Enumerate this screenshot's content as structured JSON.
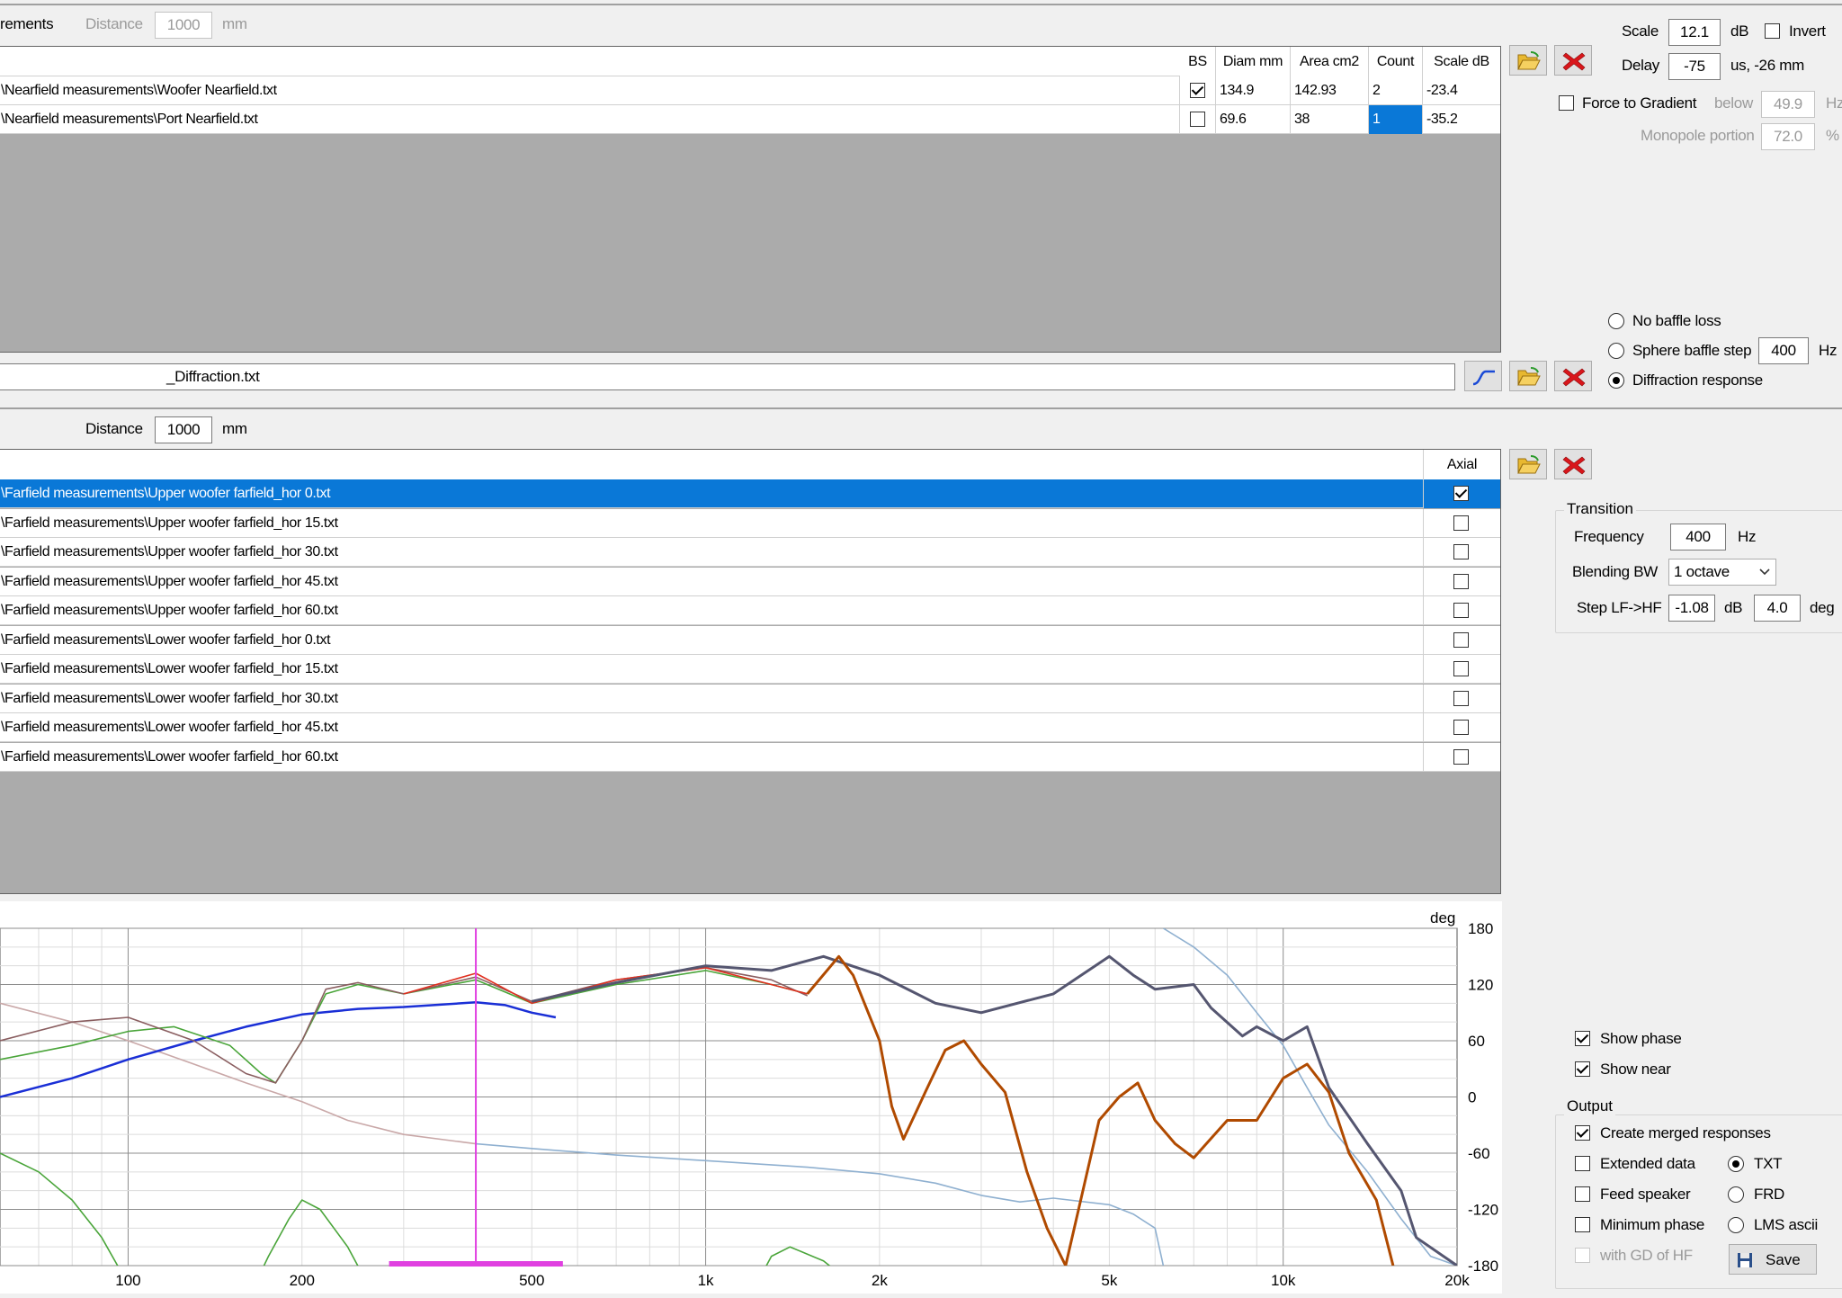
{
  "near_section": {
    "title_fragment": "rements",
    "distance_label": "Distance",
    "distance_value": "1000",
    "distance_unit": "mm",
    "columns": [
      "BS",
      "Diam mm",
      "Area cm2",
      "Count",
      "Scale dB"
    ],
    "rows": [
      {
        "file": "\\Nearfield measurements\\Woofer Nearfield.txt",
        "bs": true,
        "diam": "134.9",
        "area": "142.93",
        "count": "2",
        "scale": "-23.4"
      },
      {
        "file": "\\Nearfield measurements\\Port Nearfield.txt",
        "bs": false,
        "diam": "69.6",
        "area": "38",
        "count": "1",
        "scale": "-35.2"
      }
    ],
    "scale_label": "Scale",
    "scale_value": "12.1",
    "scale_unit": "dB",
    "invert_label": "Invert",
    "delay_label": "Delay",
    "delay_value": "-75",
    "delay_unit": "us, -26 mm",
    "force_gradient_label": "Force to Gradient",
    "below_label": "below",
    "below_value": "49.9",
    "below_unit": "Hz",
    "monopole_label": "Monopole portion",
    "monopole_value": "72.0",
    "monopole_unit": "%",
    "baffle_options": {
      "no_loss": "No baffle loss",
      "sphere": "Sphere baffle step",
      "diffraction": "Diffraction response"
    },
    "selected_baffle": "diffraction",
    "sphere_value": "400",
    "sphere_unit": "Hz",
    "diffraction_file": "_Diffraction.txt"
  },
  "far_section": {
    "distance_label": "Distance",
    "distance_value": "1000",
    "distance_unit": "mm",
    "axial_header": "Axial",
    "rows": [
      {
        "file": "\\Farfield measurements\\Upper woofer farfield_hor 0.txt",
        "axial": true
      },
      {
        "file": "\\Farfield measurements\\Upper woofer farfield_hor 15.txt",
        "axial": false
      },
      {
        "file": "\\Farfield measurements\\Upper woofer farfield_hor 30.txt",
        "axial": false
      },
      {
        "file": "\\Farfield measurements\\Upper woofer farfield_hor 45.txt",
        "axial": false
      },
      {
        "file": "\\Farfield measurements\\Upper woofer farfield_hor 60.txt",
        "axial": false
      },
      {
        "file": "\\Farfield measurements\\Lower woofer farfield_hor 0.txt",
        "axial": false
      },
      {
        "file": "\\Farfield measurements\\Lower woofer farfield_hor 15.txt",
        "axial": false
      },
      {
        "file": "\\Farfield measurements\\Lower woofer farfield_hor 30.txt",
        "axial": false
      },
      {
        "file": "\\Farfield measurements\\Lower woofer farfield_hor 45.txt",
        "axial": false
      },
      {
        "file": "\\Farfield measurements\\Lower woofer farfield_hor 60.txt",
        "axial": false
      }
    ]
  },
  "transition": {
    "title": "Transition",
    "frequency_label": "Frequency",
    "frequency_value": "400",
    "frequency_unit": "Hz",
    "blending_label": "Blending BW",
    "blending_value": "1 octave",
    "step_label": "Step LF->HF",
    "step_db_value": "-1.08",
    "step_db_unit": "dB",
    "step_deg_value": "4.0",
    "step_deg_unit": "deg"
  },
  "display": {
    "show_phase_label": "Show phase",
    "show_phase": true,
    "show_near_label": "Show near",
    "show_near": true
  },
  "output": {
    "title": "Output",
    "create_merged_label": "Create merged responses",
    "create_merged": true,
    "extended_label": "Extended data",
    "feed_label": "Feed speaker",
    "minphase_label": "Minimum phase",
    "gd_label": "with GD of HF",
    "formats": [
      "TXT",
      "FRD",
      "LMS ascii"
    ],
    "selected_format": "TXT",
    "save_label": "Save"
  },
  "colors": {
    "selection": "#0a78d7",
    "red_x": "#d9161b",
    "merged": "#b04a00",
    "near": "#1a2fd6",
    "combined_phase": "#555670",
    "marker": "#e040e0",
    "port": "#4aa53a",
    "diffraction": "#c9a8a8"
  },
  "chart_data": {
    "type": "line",
    "x_scale": "log",
    "xlim": [
      60,
      20000
    ],
    "x_ticks": [
      "100",
      "200",
      "500",
      "1k",
      "2k",
      "5k",
      "10k",
      "20k"
    ],
    "x_tick_values": [
      100,
      200,
      500,
      1000,
      2000,
      5000,
      10000,
      20000
    ],
    "right_axis_label": "deg",
    "right_ylim": [
      -180,
      180
    ],
    "right_ticks": [
      "180",
      "120",
      "60",
      "0",
      "-60",
      "-120",
      "-180"
    ],
    "right_tick_values": [
      180,
      120,
      60,
      0,
      -60,
      -120,
      -180
    ],
    "grid": true,
    "transition_marker_hz": 400,
    "blend_band_hz": [
      283,
      566
    ],
    "series": [
      {
        "key": "diffraction",
        "color": "#c9a8a8",
        "points": [
          [
            60,
            100
          ],
          [
            80,
            80
          ],
          [
            100,
            60
          ],
          [
            130,
            35
          ],
          [
            160,
            15
          ],
          [
            200,
            -5
          ],
          [
            240,
            -25
          ],
          [
            300,
            -40
          ],
          [
            400,
            -50
          ]
        ]
      },
      {
        "key": "far_light",
        "color": "#8fb0d0",
        "points": [
          [
            400,
            -50
          ],
          [
            500,
            -55
          ],
          [
            700,
            -62
          ],
          [
            1000,
            -68
          ],
          [
            1500,
            -75
          ],
          [
            2000,
            -82
          ],
          [
            2500,
            -92
          ],
          [
            3000,
            -105
          ],
          [
            3500,
            -112
          ],
          [
            4000,
            -108
          ],
          [
            5000,
            -115
          ],
          [
            5500,
            -125
          ],
          [
            6000,
            -140
          ],
          [
            6200,
            -180
          ]
        ]
      },
      {
        "key": "far_light_wrap",
        "color": "#8fb0d0",
        "points": [
          [
            6200,
            180
          ],
          [
            7000,
            160
          ],
          [
            8000,
            130
          ],
          [
            9000,
            90
          ],
          [
            10000,
            55
          ],
          [
            11000,
            10
          ],
          [
            12000,
            -30
          ],
          [
            14000,
            -80
          ],
          [
            16000,
            -130
          ],
          [
            18000,
            -170
          ],
          [
            20000,
            -180
          ]
        ]
      },
      {
        "key": "port",
        "color": "#4aa53a",
        "points": [
          [
            60,
            -60
          ],
          [
            70,
            -80
          ],
          [
            80,
            -110
          ],
          [
            90,
            -150
          ],
          [
            100,
            -200
          ]
        ]
      },
      {
        "key": "port_hump",
        "color": "#4aa53a",
        "points": [
          [
            160,
            -220
          ],
          [
            175,
            -170
          ],
          [
            190,
            -130
          ],
          [
            200,
            -110
          ],
          [
            215,
            -120
          ],
          [
            240,
            -160
          ],
          [
            260,
            -200
          ]
        ]
      },
      {
        "key": "port_tail",
        "color": "#4aa53a",
        "points": [
          [
            1200,
            -210
          ],
          [
            1300,
            -170
          ],
          [
            1400,
            -160
          ],
          [
            1600,
            -175
          ],
          [
            1800,
            -200
          ]
        ]
      },
      {
        "key": "near",
        "color": "#1a2fd6",
        "points": [
          [
            60,
            0
          ],
          [
            80,
            20
          ],
          [
            100,
            40
          ],
          [
            130,
            60
          ],
          [
            160,
            75
          ],
          [
            200,
            88
          ],
          [
            250,
            94
          ],
          [
            300,
            96
          ],
          [
            400,
            101
          ],
          [
            450,
            98
          ],
          [
            500,
            90
          ],
          [
            550,
            85
          ]
        ]
      },
      {
        "key": "far_green",
        "color": "#4aa53a",
        "points": [
          [
            60,
            40
          ],
          [
            80,
            55
          ],
          [
            100,
            70
          ],
          [
            120,
            75
          ],
          [
            150,
            55
          ],
          [
            170,
            25
          ],
          [
            180,
            15
          ],
          [
            200,
            60
          ],
          [
            220,
            110
          ],
          [
            250,
            120
          ],
          [
            300,
            110
          ],
          [
            400,
            125
          ],
          [
            500,
            100
          ],
          [
            700,
            120
          ],
          [
            1000,
            135
          ],
          [
            1300,
            120
          ],
          [
            1500,
            110
          ]
        ]
      },
      {
        "key": "far_brown",
        "color": "#8a5e60",
        "points": [
          [
            60,
            60
          ],
          [
            80,
            80
          ],
          [
            100,
            85
          ],
          [
            130,
            60
          ],
          [
            160,
            25
          ],
          [
            180,
            15
          ],
          [
            200,
            60
          ],
          [
            220,
            115
          ],
          [
            250,
            122
          ],
          [
            300,
            110
          ],
          [
            400,
            128
          ],
          [
            500,
            102
          ],
          [
            700,
            125
          ],
          [
            1000,
            138
          ],
          [
            1300,
            125
          ],
          [
            1500,
            108
          ]
        ]
      },
      {
        "key": "far_red",
        "color": "#e03020",
        "points": [
          [
            300,
            110
          ],
          [
            400,
            132
          ],
          [
            500,
            100
          ],
          [
            700,
            125
          ],
          [
            1000,
            138
          ],
          [
            1300,
            120
          ],
          [
            1500,
            110
          ]
        ]
      },
      {
        "key": "combined_phase",
        "color": "#555670",
        "points": [
          [
            500,
            102
          ],
          [
            700,
            122
          ],
          [
            1000,
            140
          ],
          [
            1300,
            135
          ],
          [
            1600,
            150
          ],
          [
            2000,
            130
          ],
          [
            2500,
            100
          ],
          [
            3000,
            90
          ],
          [
            4000,
            110
          ],
          [
            5000,
            150
          ],
          [
            5500,
            130
          ],
          [
            6000,
            115
          ],
          [
            7000,
            120
          ],
          [
            7500,
            95
          ],
          [
            8500,
            65
          ],
          [
            9000,
            75
          ],
          [
            10000,
            60
          ],
          [
            11000,
            75
          ],
          [
            12000,
            10
          ],
          [
            14000,
            -50
          ],
          [
            16000,
            -100
          ],
          [
            17000,
            -150
          ],
          [
            20000,
            -180
          ]
        ]
      },
      {
        "key": "merged",
        "color": "#b04a00",
        "points": [
          [
            1500,
            110
          ],
          [
            1700,
            150
          ],
          [
            1800,
            130
          ],
          [
            2000,
            60
          ],
          [
            2100,
            -10
          ],
          [
            2200,
            -45
          ],
          [
            2400,
            5
          ],
          [
            2600,
            50
          ],
          [
            2800,
            60
          ],
          [
            3000,
            35
          ],
          [
            3300,
            5
          ],
          [
            3600,
            -80
          ],
          [
            3900,
            -140
          ],
          [
            4200,
            -180
          ]
        ]
      },
      {
        "key": "merged_b",
        "color": "#b04a00",
        "points": [
          [
            4200,
            -180
          ],
          [
            4500,
            -100
          ],
          [
            4800,
            -25
          ],
          [
            5200,
            0
          ],
          [
            5600,
            15
          ],
          [
            6000,
            -25
          ],
          [
            6500,
            -50
          ],
          [
            7000,
            -65
          ],
          [
            8000,
            -25
          ],
          [
            9000,
            -25
          ],
          [
            10000,
            20
          ],
          [
            11000,
            35
          ],
          [
            12000,
            5
          ],
          [
            13000,
            -60
          ],
          [
            14500,
            -110
          ],
          [
            15500,
            -180
          ]
        ]
      }
    ]
  }
}
